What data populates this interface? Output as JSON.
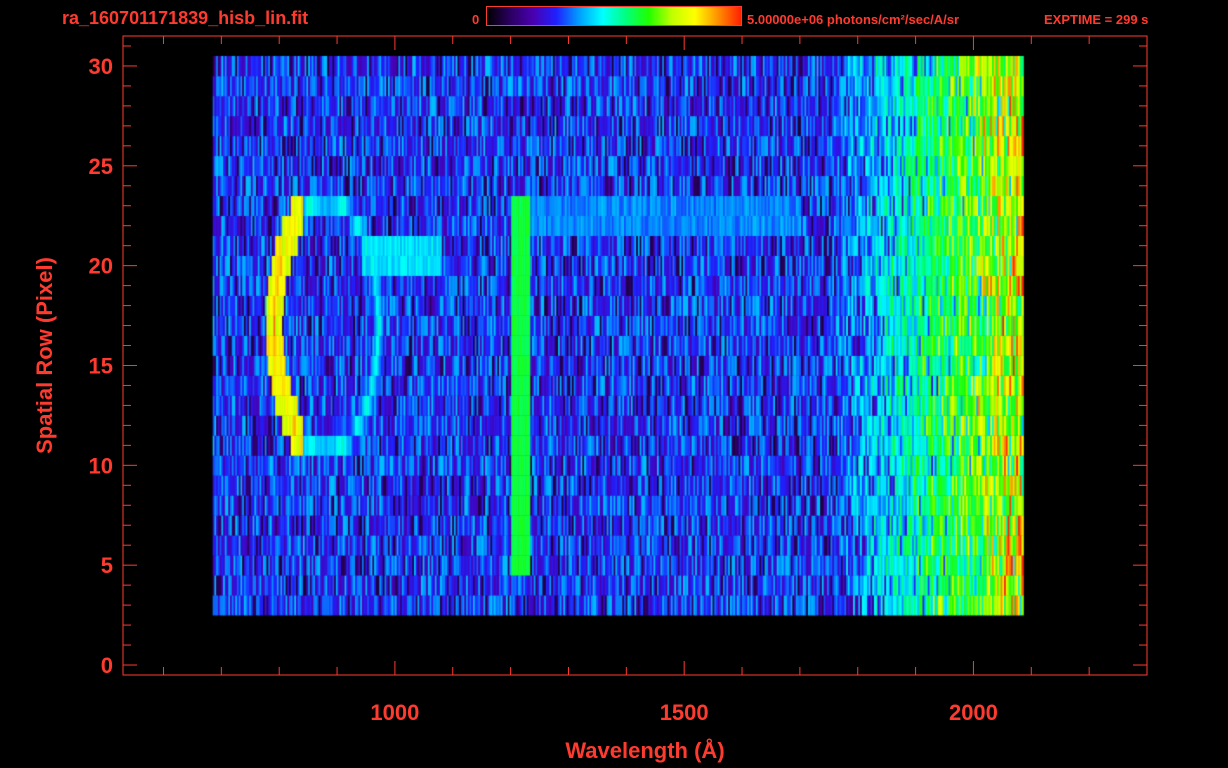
{
  "header": {
    "filename": "ra_160701171839_hisb_lin.fit",
    "colorbar_min_label": "0",
    "colorbar_max_label": "5.00000e+06 photons/cm²/sec/A/sr",
    "exptime_label": "EXPTIME = 299 s"
  },
  "colors": {
    "axis": "#ff3b30",
    "background": "#000000",
    "colormap": [
      "#000000",
      "#2a0060",
      "#4a00b0",
      "#2020ff",
      "#00a0ff",
      "#00ffff",
      "#00ff80",
      "#20ff00",
      "#c0ff00",
      "#ffff00",
      "#ff9000",
      "#ff2000"
    ]
  },
  "chart_data": {
    "type": "heatmap",
    "title": "ra_160701171839_hisb_lin.fit",
    "xlabel": "Wavelength (Å)",
    "ylabel": "Spatial Row (Pixel)",
    "xlim": [
      530,
      2300
    ],
    "ylim": [
      -0.5,
      31.5
    ],
    "xticks": [
      1000,
      1500,
      2000
    ],
    "yticks": [
      0,
      5,
      10,
      15,
      20,
      25,
      30
    ],
    "x_minor_step": 100,
    "y_minor_step": 1,
    "colorbar_range": [
      0,
      5000000
    ],
    "colorbar_units": "photons/cm²/sec/A/sr",
    "exptime_s": 299,
    "detector_extent": {
      "x": [
        685,
        2085
      ],
      "rows": [
        3,
        30
      ]
    },
    "features": [
      {
        "name": "oxygen-ring-inner-shell",
        "center_x": 870,
        "center_row": 17,
        "half_width_x": 80,
        "half_height_rows": 6.5,
        "peak_fraction": 0.55
      },
      {
        "name": "oxygen-ring-outer-shell",
        "center_x": 880,
        "center_row": 17,
        "half_width_x": 100,
        "half_height_rows": 7,
        "peak_fraction": 0.95
      },
      {
        "name": "lyman-alpha-line",
        "x": 1216,
        "rows": [
          5,
          23
        ],
        "peak_fraction": 0.62
      },
      {
        "name": "upper-horizontal-band",
        "rows": [
          22,
          23
        ],
        "x": [
          1230,
          1700
        ],
        "peak_fraction": 0.35
      },
      {
        "name": "mid-horizontal-band",
        "rows": [
          20,
          21
        ],
        "x": [
          940,
          1080
        ],
        "peak_fraction": 0.45
      },
      {
        "name": "long-wavelength-rise",
        "x": [
          1750,
          2065
        ],
        "peak_fraction": 0.6
      }
    ]
  }
}
